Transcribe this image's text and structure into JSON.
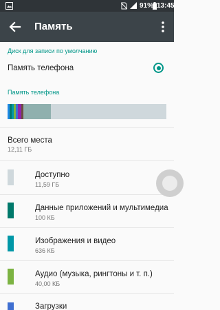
{
  "status_bar": {
    "battery_percent": "91%",
    "time": "13:45"
  },
  "app_bar": {
    "title": "Память"
  },
  "default_disk": {
    "header": "Диск для записи по умолчанию",
    "option_label": "Память телефона",
    "selected": true
  },
  "phone_storage": {
    "header": "Память телефона",
    "total_label": "Всего места",
    "total_value": "12,11 ГБ"
  },
  "colors": {
    "accent": "#009688",
    "available": "#cfd8dc",
    "apps": "#00796b",
    "images": "#0097a7",
    "audio": "#7cb342",
    "downloads": "#3f6fd1"
  },
  "categories": [
    {
      "label": "Доступно",
      "value": "11,59 ГБ",
      "color": "#cfd8dc"
    },
    {
      "label": "Данные приложений и мультимедиа",
      "value": "100 КБ",
      "color": "#00796b"
    },
    {
      "label": "Изображения и видео",
      "value": "636 КБ",
      "color": "#0097a7"
    },
    {
      "label": "Аудио (музыка, рингтоны и т. п.)",
      "value": "40,00 КБ",
      "color": "#7cb342"
    },
    {
      "label": "Загрузки",
      "value": "",
      "color": "#3f6fd1"
    }
  ]
}
